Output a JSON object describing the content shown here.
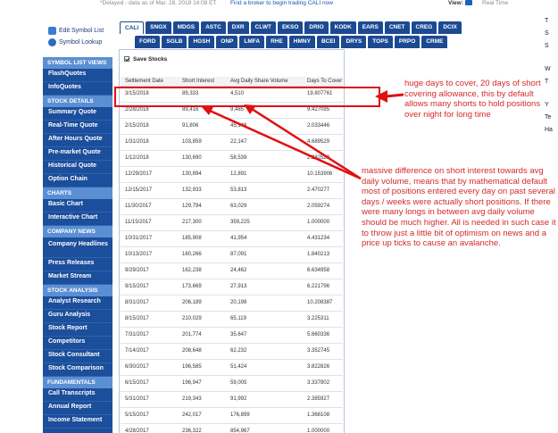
{
  "topbar": {
    "delayed_text": "*Delayed - data as of Mar. 28, 2018 14:08 ET",
    "broker_text": "Find a broker to begin trading CALI now",
    "view_label": "View:",
    "realtime_text": "Real Time"
  },
  "side_links": {
    "edit_symbol_list": "Edit Symbol List",
    "symbol_lookup": "Symbol Lookup"
  },
  "sidebar": {
    "sections": [
      {
        "header": "SYMBOL LIST VIEWS",
        "items": [
          "FlashQuotes",
          "InfoQuotes"
        ]
      },
      {
        "header": "STOCK DETAILS",
        "items": [
          "Summary Quote",
          "Real-Time Quote",
          "After Hours Quote",
          "Pre-market Quote",
          "Historical Quote",
          "Option Chain"
        ]
      },
      {
        "header": "CHARTS",
        "items": [
          "Basic Chart",
          "Interactive Chart"
        ]
      },
      {
        "header": "COMPANY NEWS",
        "items": [
          "Company Headlines",
          "Press Releases",
          "Market Stream"
        ]
      },
      {
        "header": "STOCK ANALYSIS",
        "items": [
          "Analyst Research",
          "Guru Analysis",
          "Stock Report",
          "Competitors",
          "Stock Consultant",
          "Stock Comparison"
        ]
      },
      {
        "header": "FUNDAMENTALS",
        "items": [
          "Call Transcripts",
          "Annual Report",
          "Income Statement"
        ]
      }
    ]
  },
  "tabs_row1": [
    "CALI",
    "SNGX",
    "MDGS",
    "ASTC",
    "DXR",
    "CLWT",
    "EKSO",
    "DRIO",
    "KODK",
    "EARS",
    "CNET",
    "CREG",
    "DCIX"
  ],
  "tabs_row2": [
    "FORD",
    "SGLB",
    "HGSH",
    "ONP",
    "LMFA",
    "RHE",
    "HMNY",
    "BCEI",
    "DRYS",
    "TOPS",
    "PRPO",
    "CRME"
  ],
  "save_stocks_label": "Save Stocks",
  "table": {
    "headers": [
      "Settlement Date",
      "Short Interest",
      "Avg Daily Share Volume",
      "Days To Cover"
    ],
    "rows": [
      [
        "3/15/2018",
        "89,333",
        "4,510",
        "19.807761"
      ],
      [
        "2/28/2018",
        "89,416",
        "9,485",
        "9.427095"
      ],
      [
        "2/15/2018",
        "91,806",
        "45,148",
        "2.033446"
      ],
      [
        "1/31/2018",
        "103,859",
        "22,147",
        "4.689529"
      ],
      [
        "1/12/2018",
        "130,690",
        "58,539",
        "2.232529"
      ],
      [
        "12/29/2017",
        "130,894",
        "12,891",
        "10.153906"
      ],
      [
        "12/15/2017",
        "132,933",
        "53,813",
        "2.470277"
      ],
      [
        "11/30/2017",
        "129,794",
        "63,029",
        "2.059274"
      ],
      [
        "11/15/2017",
        "217,300",
        "359,225",
        "1.000000"
      ],
      [
        "10/31/2017",
        "185,908",
        "41,954",
        "4.431234"
      ],
      [
        "10/13/2017",
        "160,266",
        "87,091",
        "1.840213"
      ],
      [
        "9/29/2017",
        "162,238",
        "24,462",
        "6.634958"
      ],
      [
        "9/15/2017",
        "173,669",
        "27,913",
        "6.221796"
      ],
      [
        "8/31/2017",
        "206,189",
        "20,198",
        "10.208387"
      ],
      [
        "8/15/2017",
        "210,029",
        "65,119",
        "3.225311"
      ],
      [
        "7/31/2017",
        "201,774",
        "35,647",
        "5.660336"
      ],
      [
        "7/14/2017",
        "208,648",
        "62,232",
        "3.352745"
      ],
      [
        "6/30/2017",
        "196,585",
        "51,424",
        "3.822826"
      ],
      [
        "6/15/2017",
        "196,947",
        "59,005",
        "3.337802"
      ],
      [
        "5/31/2017",
        "219,343",
        "91,992",
        "2.385927"
      ],
      [
        "5/15/2017",
        "242,017",
        "176,899",
        "1.368108"
      ],
      [
        "4/28/2017",
        "236,322",
        "854,967",
        "1.000000"
      ]
    ]
  },
  "annotations": {
    "top_note": "huge days to cover, 20 days of short covering allowance, this by default allows many shorts to hold positions over night for long time",
    "mid_note": "massive difference on short interest towards avg daily volume, means that by mathematical default most of positions entered every day on past several days / weeks were actually short positions. If there were many longs in between avg daily volume should be much higher. All is needed in such case it to throw just a little bit of optimism on news and a price up ticks to cause an avalanche.",
    "color": "#d42a2a"
  },
  "right_edge": [
    "T",
    "S",
    "S",
    "W",
    "T",
    "Y",
    "Te",
    "Ha"
  ]
}
